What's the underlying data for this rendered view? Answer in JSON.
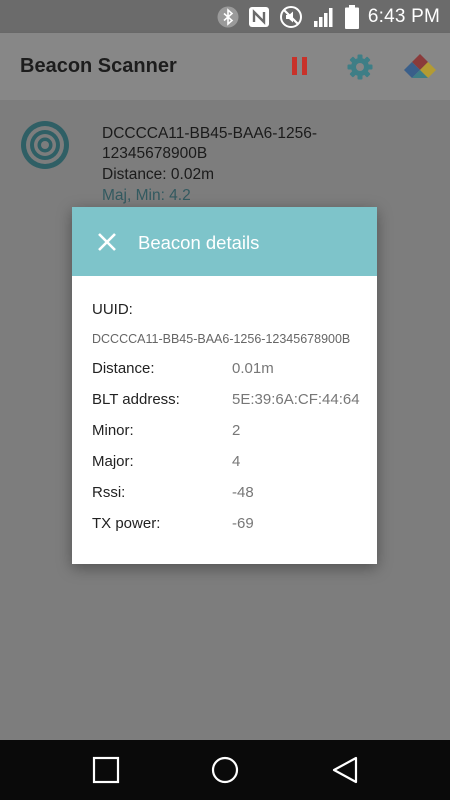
{
  "status_bar": {
    "time": "6:43 PM",
    "icons": [
      "bluetooth-icon",
      "nfc-icon",
      "mute-icon",
      "signal-icon",
      "battery-icon"
    ]
  },
  "app_bar": {
    "title": "Beacon Scanner",
    "actions": [
      "pause-icon",
      "gear-icon",
      "app-logo-icon"
    ],
    "pause_color": "#c8322a",
    "gear_color": "#3e7e86"
  },
  "beacon_list": {
    "items": [
      {
        "uuid": "DCCCCA11-BB45-BAA6-1256-12345678900B",
        "distance": "Distance: 0.02m",
        "maj_min": "Maj, Min: 4.2"
      }
    ]
  },
  "dialog": {
    "title": "Beacon details",
    "header_color": "#7ec4ca",
    "uuid_label": "UUID:",
    "uuid_value": "DCCCCA11-BB45-BAA6-1256-12345678900B",
    "rows": [
      {
        "label": "Distance:",
        "value": "0.01m"
      },
      {
        "label": "BLT address:",
        "value": "5E:39:6A:CF:44:64"
      },
      {
        "label": "Minor:",
        "value": "2"
      },
      {
        "label": "Major:",
        "value": "4"
      },
      {
        "label": "Rssi:",
        "value": "-48"
      },
      {
        "label": "TX power:",
        "value": "-69"
      }
    ]
  },
  "nav_bar": {
    "buttons": [
      "recent-apps-icon",
      "home-icon",
      "back-icon"
    ]
  }
}
